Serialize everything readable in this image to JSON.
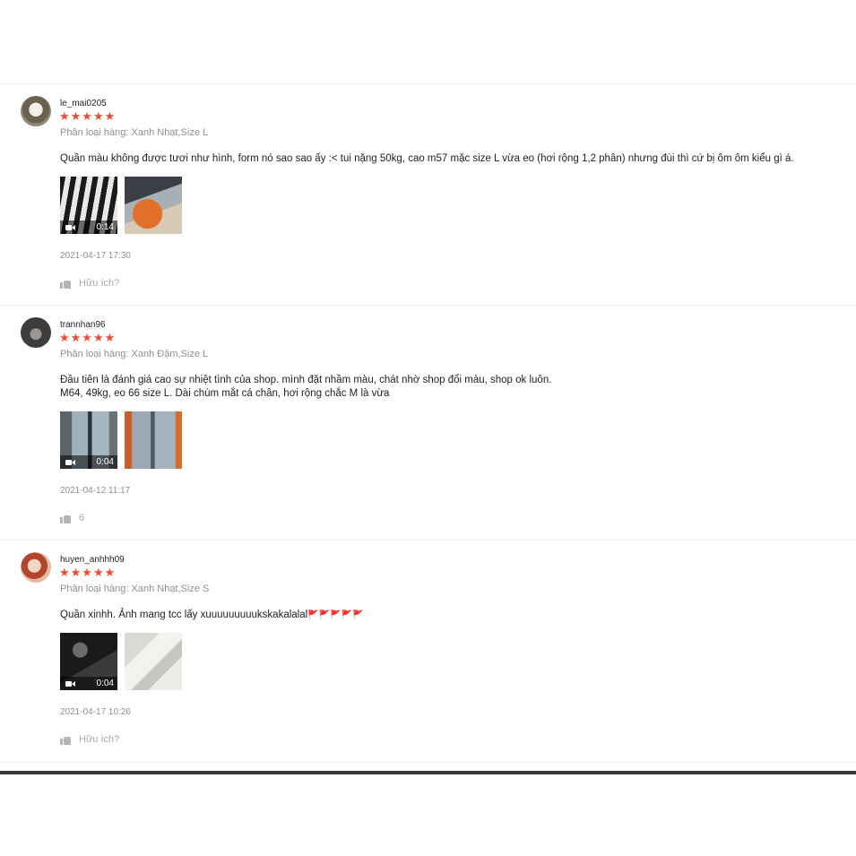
{
  "reviews": [
    {
      "username": "le_mai0205",
      "stars": "★★★★★",
      "rating": 5,
      "variation": "Phân loại hàng: Xanh Nhạt,Size L",
      "comment": "Quần màu không được tươi như hình, form nó sao sao ấy :< tui nặng 50kg, cao m57 mặc size L vừa eo (hơi rộng 1,2 phân) nhưng đùi thì cứ bị ôm ôm kiểu gì á.",
      "video_duration": "0:14",
      "date": "2021-04-17 17:30",
      "helpful": "Hữu ích?"
    },
    {
      "username": "trannhan96",
      "stars": "★★★★★",
      "rating": 5,
      "variation": "Phân loại hàng: Xanh Đậm,Size L",
      "comment": "Đầu tiên là đánh giá cao sự nhiệt tình của shop. mình đặt nhầm màu, chát nhờ shop đổi màu, shop ok luôn.\nM64, 49kg, eo 66 size L. Dài chùm mắt cá chân, hơi rộng chắc M là vừa",
      "video_duration": "0:04",
      "date": "2021-04-12 11:17",
      "helpful": "6"
    },
    {
      "username": "huyen_anhhh09",
      "stars": "★★★★★",
      "rating": 5,
      "variation": "Phân loại hàng: Xanh Nhạt,Size S",
      "comment": "Quần xinhh. Ảnh mang tcc lấy xuuuuuuuuukskakalalal",
      "flags": "🚩🚩🚩🚩🚩",
      "video_duration": "0:04",
      "date": "2021-04-17 10:26",
      "helpful": "Hữu ích?"
    }
  ],
  "colors": {
    "star": "#ee4d2d",
    "muted": "#8f8f8f",
    "divider": "#ececec"
  },
  "icons": [
    "video-camera-icon",
    "thumbs-up-icon"
  ]
}
